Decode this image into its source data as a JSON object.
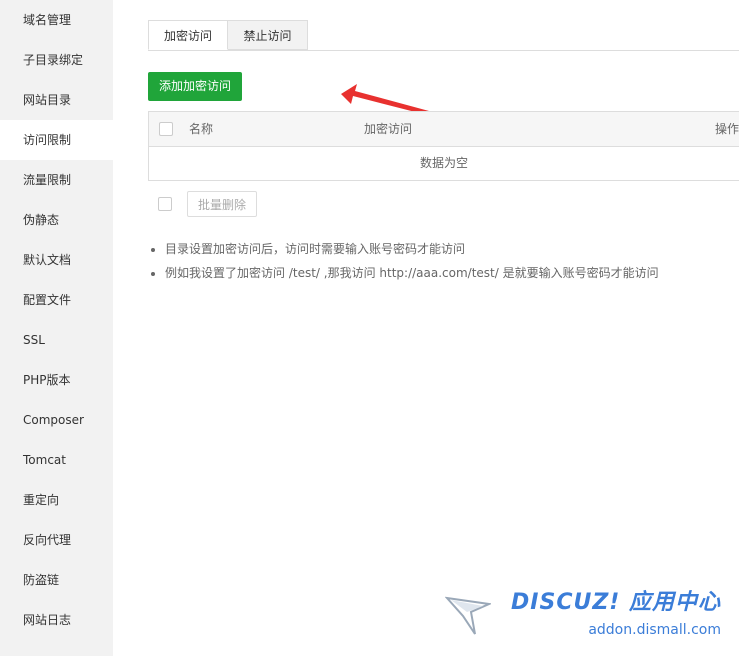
{
  "sidebar": {
    "items": [
      {
        "label": "域名管理"
      },
      {
        "label": "子目录绑定"
      },
      {
        "label": "网站目录"
      },
      {
        "label": "访问限制"
      },
      {
        "label": "流量限制"
      },
      {
        "label": "伪静态"
      },
      {
        "label": "默认文档"
      },
      {
        "label": "配置文件"
      },
      {
        "label": "SSL"
      },
      {
        "label": "PHP版本"
      },
      {
        "label": "Composer"
      },
      {
        "label": "Tomcat"
      },
      {
        "label": "重定向"
      },
      {
        "label": "反向代理"
      },
      {
        "label": "防盗链"
      },
      {
        "label": "网站日志"
      }
    ],
    "active_index": 3
  },
  "tabs": {
    "encrypt": "加密访问",
    "forbid": "禁止访问"
  },
  "add_button": "添加加密访问",
  "table": {
    "col_name": "名称",
    "col_encrypt": "加密访问",
    "col_ops": "操作",
    "empty": "数据为空"
  },
  "batch_delete": "批量删除",
  "tips": [
    "目录设置加密访问后，访问时需要输入账号密码才能访问",
    "例如我设置了加密访问 /test/ ,那我访问 http://aaa.com/test/ 是就要输入账号密码才能访问"
  ],
  "watermark": {
    "brand": "DISCUZ! 应用中心",
    "url": "addon.dismall.com"
  },
  "colors": {
    "accent_green": "#20a53a",
    "arrow_red": "#e8312f",
    "watermark_blue": "#3b7dd8"
  }
}
